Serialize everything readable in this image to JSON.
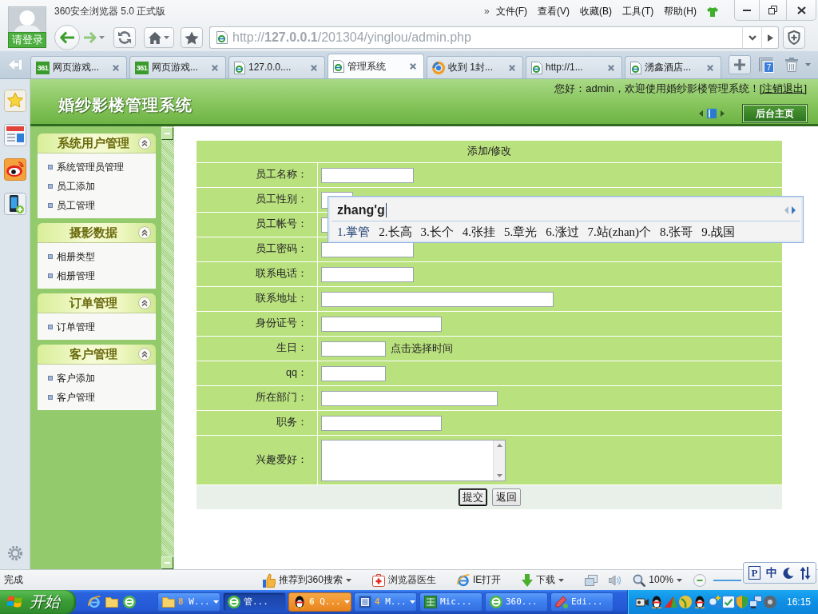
{
  "browser": {
    "title": "360安全浏览器 5.0 正式版",
    "login": "请登录",
    "menu_more": "»",
    "menu": [
      "文件(F)",
      "查看(V)",
      "收藏(B)",
      "工具(T)",
      "帮助(H)"
    ],
    "url": "http://**127.0.0.1**/201304/yinglou/admin.php",
    "tabs": [
      {
        "kind": "game",
        "logo": "361",
        "label": "网页游戏...",
        "selected": false
      },
      {
        "kind": "game",
        "logo": "361",
        "label": "网页游戏...",
        "selected": false
      },
      {
        "kind": "page",
        "label": "127.0.0....",
        "selected": false
      },
      {
        "kind": "page",
        "label": "管理系统",
        "selected": true
      },
      {
        "kind": "mail",
        "label": "收到 1封...",
        "selected": false
      },
      {
        "kind": "page",
        "label": "http://1...",
        "selected": false
      },
      {
        "kind": "page",
        "label": "湧鑫酒店...",
        "selected": false
      }
    ],
    "tab_count": "7"
  },
  "page": {
    "site_title": "婚纱影楼管理系统",
    "greeting": "您好：admin，欢迎使用婚纱影楼管理系统！",
    "logout": "[注销退出]",
    "home_button": "后台主页",
    "sidebar": [
      {
        "title": "系统用户管理",
        "expanded": true,
        "items": [
          "系统管理员管理",
          "员工添加",
          "员工管理"
        ]
      },
      {
        "title": "摄影数据",
        "expanded": true,
        "items": [
          "相册类型",
          "相册管理"
        ]
      },
      {
        "title": "订单管理",
        "expanded": true,
        "items": [
          "订单管理"
        ]
      },
      {
        "title": "客户管理",
        "expanded": true,
        "items": [
          "客户添加",
          "客户管理"
        ]
      }
    ],
    "form": {
      "title": "添加/修改",
      "fields": [
        {
          "kind": "text",
          "label": "员工名称："
        },
        {
          "kind": "select",
          "label": "员工性别："
        },
        {
          "kind": "text",
          "label": "员工帐号："
        },
        {
          "kind": "text",
          "label": "员工密码："
        },
        {
          "kind": "text",
          "label": "联系电话："
        },
        {
          "kind": "text",
          "label": "联系地址："
        },
        {
          "kind": "text",
          "label": "身份证号："
        },
        {
          "kind": "date",
          "label": "生日：",
          "hint": "点击选择时间"
        },
        {
          "kind": "text",
          "label": "qq："
        },
        {
          "kind": "text",
          "label": "所在部门："
        },
        {
          "kind": "text",
          "label": "职务："
        },
        {
          "kind": "textarea",
          "label": "兴趣爱好："
        }
      ],
      "buttons": [
        {
          "label": "提交",
          "focused": true
        },
        {
          "label": "返回",
          "focused": false
        }
      ]
    }
  },
  "ime": {
    "input": "zhang'g",
    "candidates": [
      {
        "label": "1.掌管",
        "selected": true
      },
      {
        "label": "2.长高",
        "selected": false
      },
      {
        "label": "3.长个",
        "selected": false
      },
      {
        "label": "4.张挂",
        "selected": false
      },
      {
        "label": "5.章光",
        "selected": false
      },
      {
        "label": "6.涨过",
        "selected": false
      },
      {
        "label": "7.站(zhan)个",
        "selected": false
      },
      {
        "label": "8.张哥",
        "selected": false
      },
      {
        "label": "9.战国",
        "selected": false
      }
    ]
  },
  "status_bar": {
    "text": "完成",
    "items": [
      {
        "kind": "recommend",
        "label": "推荐到360搜索",
        "dropdown": true
      },
      {
        "kind": "doctor",
        "label": "浏览器医生",
        "dropdown": false
      },
      {
        "kind": "ie",
        "label": "IE打开",
        "dropdown": false
      },
      {
        "kind": "download",
        "label": "下载",
        "dropdown": true
      }
    ],
    "zoom": "100%"
  },
  "ime_toolbar": {
    "logo": "P",
    "mode": "中"
  },
  "taskbar": {
    "start": "开始",
    "tasks": [
      {
        "kind": "folder",
        "count": "8",
        "label": "W...",
        "selected": false,
        "flashing": false
      },
      {
        "kind": "browser360",
        "label": "管...",
        "selected": true,
        "flashing": false
      },
      {
        "kind": "chat",
        "count": "6",
        "label": "Q...",
        "selected": false,
        "flashing": true
      },
      {
        "kind": "word",
        "count": "4",
        "label": "M...",
        "selected": false,
        "flashing": false
      },
      {
        "kind": "excel",
        "label": "Mic...",
        "selected": false,
        "flashing": false
      },
      {
        "kind": "browser360",
        "label": "360...",
        "selected": false,
        "flashing": false
      },
      {
        "kind": "editor",
        "label": "Edi...",
        "selected": false,
        "flashing": false
      }
    ],
    "clock": "16:15"
  }
}
